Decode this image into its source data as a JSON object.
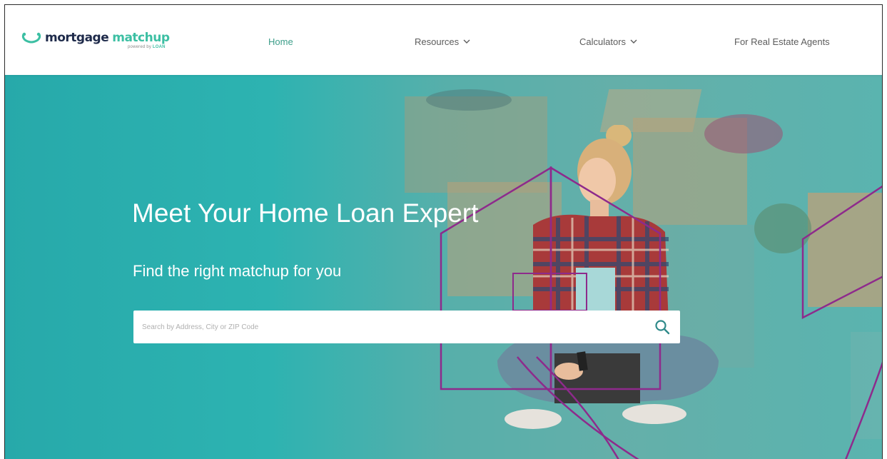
{
  "brand": {
    "part1": "mortgage",
    "part2": "matchup",
    "sub_prefix": "powered by",
    "sub_brand": "LOAN",
    "colors": {
      "navy": "#1e2a4a",
      "teal": "#3cbfa3"
    }
  },
  "nav": {
    "items": [
      {
        "label": "Home",
        "active": true,
        "dropdown": false
      },
      {
        "label": "Resources",
        "active": false,
        "dropdown": true
      },
      {
        "label": "Calculators",
        "active": false,
        "dropdown": true
      },
      {
        "label": "For Real Estate Agents",
        "active": false,
        "dropdown": false
      }
    ]
  },
  "hero": {
    "title": "Meet Your Home Loan Expert",
    "subtitle": "Find the right matchup for you",
    "background_color": "#2eb0b0",
    "accent_outline_color": "#8e2a8c"
  },
  "search": {
    "placeholder": "Search by Address, City or ZIP Code",
    "value": "",
    "icon": "search-icon"
  }
}
